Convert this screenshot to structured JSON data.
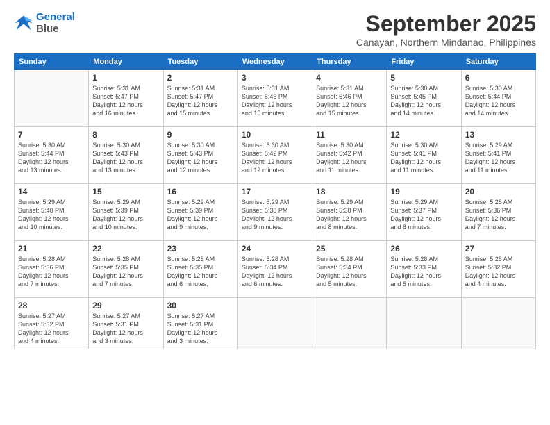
{
  "logo": {
    "line1": "General",
    "line2": "Blue"
  },
  "title": "September 2025",
  "location": "Canayan, Northern Mindanao, Philippines",
  "weekdays": [
    "Sunday",
    "Monday",
    "Tuesday",
    "Wednesday",
    "Thursday",
    "Friday",
    "Saturday"
  ],
  "weeks": [
    [
      {
        "day": "",
        "info": ""
      },
      {
        "day": "1",
        "info": "Sunrise: 5:31 AM\nSunset: 5:47 PM\nDaylight: 12 hours\nand 16 minutes."
      },
      {
        "day": "2",
        "info": "Sunrise: 5:31 AM\nSunset: 5:47 PM\nDaylight: 12 hours\nand 15 minutes."
      },
      {
        "day": "3",
        "info": "Sunrise: 5:31 AM\nSunset: 5:46 PM\nDaylight: 12 hours\nand 15 minutes."
      },
      {
        "day": "4",
        "info": "Sunrise: 5:31 AM\nSunset: 5:46 PM\nDaylight: 12 hours\nand 15 minutes."
      },
      {
        "day": "5",
        "info": "Sunrise: 5:30 AM\nSunset: 5:45 PM\nDaylight: 12 hours\nand 14 minutes."
      },
      {
        "day": "6",
        "info": "Sunrise: 5:30 AM\nSunset: 5:44 PM\nDaylight: 12 hours\nand 14 minutes."
      }
    ],
    [
      {
        "day": "7",
        "info": "Sunrise: 5:30 AM\nSunset: 5:44 PM\nDaylight: 12 hours\nand 13 minutes."
      },
      {
        "day": "8",
        "info": "Sunrise: 5:30 AM\nSunset: 5:43 PM\nDaylight: 12 hours\nand 13 minutes."
      },
      {
        "day": "9",
        "info": "Sunrise: 5:30 AM\nSunset: 5:43 PM\nDaylight: 12 hours\nand 12 minutes."
      },
      {
        "day": "10",
        "info": "Sunrise: 5:30 AM\nSunset: 5:42 PM\nDaylight: 12 hours\nand 12 minutes."
      },
      {
        "day": "11",
        "info": "Sunrise: 5:30 AM\nSunset: 5:42 PM\nDaylight: 12 hours\nand 11 minutes."
      },
      {
        "day": "12",
        "info": "Sunrise: 5:30 AM\nSunset: 5:41 PM\nDaylight: 12 hours\nand 11 minutes."
      },
      {
        "day": "13",
        "info": "Sunrise: 5:29 AM\nSunset: 5:41 PM\nDaylight: 12 hours\nand 11 minutes."
      }
    ],
    [
      {
        "day": "14",
        "info": "Sunrise: 5:29 AM\nSunset: 5:40 PM\nDaylight: 12 hours\nand 10 minutes."
      },
      {
        "day": "15",
        "info": "Sunrise: 5:29 AM\nSunset: 5:39 PM\nDaylight: 12 hours\nand 10 minutes."
      },
      {
        "day": "16",
        "info": "Sunrise: 5:29 AM\nSunset: 5:39 PM\nDaylight: 12 hours\nand 9 minutes."
      },
      {
        "day": "17",
        "info": "Sunrise: 5:29 AM\nSunset: 5:38 PM\nDaylight: 12 hours\nand 9 minutes."
      },
      {
        "day": "18",
        "info": "Sunrise: 5:29 AM\nSunset: 5:38 PM\nDaylight: 12 hours\nand 8 minutes."
      },
      {
        "day": "19",
        "info": "Sunrise: 5:29 AM\nSunset: 5:37 PM\nDaylight: 12 hours\nand 8 minutes."
      },
      {
        "day": "20",
        "info": "Sunrise: 5:28 AM\nSunset: 5:36 PM\nDaylight: 12 hours\nand 7 minutes."
      }
    ],
    [
      {
        "day": "21",
        "info": "Sunrise: 5:28 AM\nSunset: 5:36 PM\nDaylight: 12 hours\nand 7 minutes."
      },
      {
        "day": "22",
        "info": "Sunrise: 5:28 AM\nSunset: 5:35 PM\nDaylight: 12 hours\nand 7 minutes."
      },
      {
        "day": "23",
        "info": "Sunrise: 5:28 AM\nSunset: 5:35 PM\nDaylight: 12 hours\nand 6 minutes."
      },
      {
        "day": "24",
        "info": "Sunrise: 5:28 AM\nSunset: 5:34 PM\nDaylight: 12 hours\nand 6 minutes."
      },
      {
        "day": "25",
        "info": "Sunrise: 5:28 AM\nSunset: 5:34 PM\nDaylight: 12 hours\nand 5 minutes."
      },
      {
        "day": "26",
        "info": "Sunrise: 5:28 AM\nSunset: 5:33 PM\nDaylight: 12 hours\nand 5 minutes."
      },
      {
        "day": "27",
        "info": "Sunrise: 5:28 AM\nSunset: 5:32 PM\nDaylight: 12 hours\nand 4 minutes."
      }
    ],
    [
      {
        "day": "28",
        "info": "Sunrise: 5:27 AM\nSunset: 5:32 PM\nDaylight: 12 hours\nand 4 minutes."
      },
      {
        "day": "29",
        "info": "Sunrise: 5:27 AM\nSunset: 5:31 PM\nDaylight: 12 hours\nand 3 minutes."
      },
      {
        "day": "30",
        "info": "Sunrise: 5:27 AM\nSunset: 5:31 PM\nDaylight: 12 hours\nand 3 minutes."
      },
      {
        "day": "",
        "info": ""
      },
      {
        "day": "",
        "info": ""
      },
      {
        "day": "",
        "info": ""
      },
      {
        "day": "",
        "info": ""
      }
    ]
  ]
}
